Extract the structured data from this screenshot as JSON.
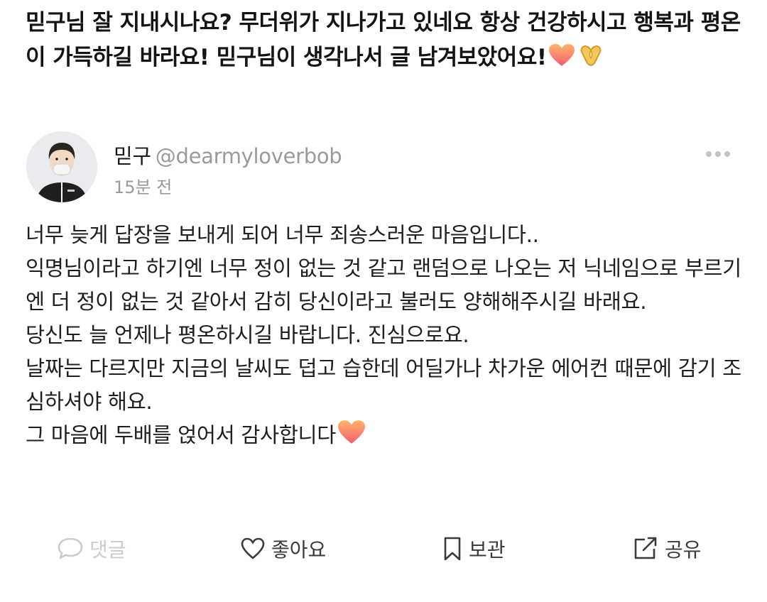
{
  "question": {
    "text": "믿구님 잘 지내시나요? 무더위가 지나가고 있네요 항상 건강하시고 행복과 평온이 가득하길 바라요! 믿구님이 생각나서 글 남겨보았어요!"
  },
  "author": {
    "name": "믿구",
    "handle": "@dearmyloverbob",
    "time": "15분 전"
  },
  "answer": {
    "paragraphs": [
      "너무 늦게 답장을 보내게 되어 너무 죄송스러운 마음입니다..",
      "익명님이라고 하기엔 너무 정이 없는 것 같고 랜덤으로 나오는 저 닉네임으로 부르기엔 더 정이 없는 것 같아서 감히 당신이라고 불러도 양해해주시길 바래요.",
      "당신도 늘 언제나 평온하시길 바랍니다. 진심으로요.",
      "날짜는 다르지만 지금의 날씨도 덥고 습한데 어딜가나 차가운 에어컨 때문에 감기 조심하셔야 해요.",
      "그 마음에 두배를 얹어서 감사합니다"
    ]
  },
  "actions": {
    "comment": "댓글",
    "like": "좋아요",
    "save": "보관",
    "share": "공유"
  },
  "colors": {
    "text": "#1a1a1a",
    "muted": "#9a9a9a",
    "disabled": "#cccccc",
    "heart": "#f07a45"
  }
}
